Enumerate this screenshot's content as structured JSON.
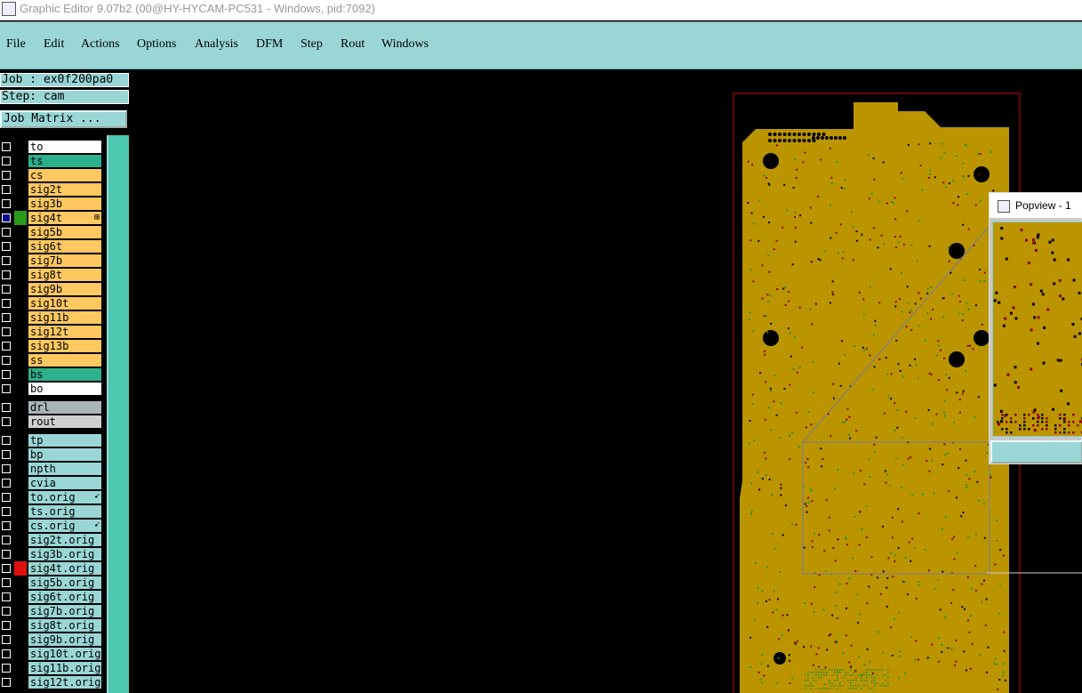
{
  "window": {
    "title": "Graphic Editor 9.07b2 (00@HY-HYCAM-PC531 - Windows, pid:7092)"
  },
  "menu": [
    "File",
    "Edit",
    "Actions",
    "Options",
    "Analysis",
    "DFM",
    "Step",
    "Rout",
    "Windows"
  ],
  "info": {
    "job": "Job : ex0f200pa0",
    "step": "Step: cam",
    "job_matrix": "Job Matrix ..."
  },
  "colors": {
    "board": "#bb9500",
    "board_outline": "#d00000",
    "menu_bg": "#9ad6d6",
    "layer_signal": "#ffc861",
    "layer_mask": "#2db08c",
    "layer_white": "#ffffff",
    "layer_drill": "#a8b4b8",
    "layer_rout": "#d0d0d0",
    "layer_misc": "#9ad6d6"
  },
  "layers": [
    {
      "name": "to",
      "type": "white"
    },
    {
      "name": "ts",
      "type": "mask"
    },
    {
      "name": "cs",
      "type": "signal"
    },
    {
      "name": "sig2t",
      "type": "signal"
    },
    {
      "name": "sig3b",
      "type": "signal"
    },
    {
      "name": "sig4t",
      "type": "signal",
      "checked": true,
      "swatch": "#2a9a1a",
      "mark": "⊞"
    },
    {
      "name": "sig5b",
      "type": "signal"
    },
    {
      "name": "sig6t",
      "type": "signal"
    },
    {
      "name": "sig7b",
      "type": "signal"
    },
    {
      "name": "sig8t",
      "type": "signal"
    },
    {
      "name": "sig9b",
      "type": "signal"
    },
    {
      "name": "sig10t",
      "type": "signal"
    },
    {
      "name": "sig11b",
      "type": "signal"
    },
    {
      "name": "sig12t",
      "type": "signal"
    },
    {
      "name": "sig13b",
      "type": "signal"
    },
    {
      "name": "ss",
      "type": "signal"
    },
    {
      "name": "bs",
      "type": "mask"
    },
    {
      "name": "bo",
      "type": "white"
    },
    {
      "name": "drl",
      "type": "drill",
      "gap": true
    },
    {
      "name": "rout",
      "type": "rout"
    },
    {
      "name": "tp",
      "type": "misc",
      "gap": true
    },
    {
      "name": "bp",
      "type": "misc"
    },
    {
      "name": "npth",
      "type": "misc"
    },
    {
      "name": "cvia",
      "type": "misc"
    },
    {
      "name": "to.orig",
      "type": "misc",
      "mark": "➹"
    },
    {
      "name": "ts.orig",
      "type": "misc"
    },
    {
      "name": "cs.orig",
      "type": "misc",
      "mark": "➹"
    },
    {
      "name": "sig2t.orig",
      "type": "misc"
    },
    {
      "name": "sig3b.orig",
      "type": "misc"
    },
    {
      "name": "sig4t.orig",
      "type": "misc",
      "swatch": "#e01010"
    },
    {
      "name": "sig5b.orig",
      "type": "misc"
    },
    {
      "name": "sig6t.orig",
      "type": "misc"
    },
    {
      "name": "sig7b.orig",
      "type": "misc"
    },
    {
      "name": "sig8t.orig",
      "type": "misc"
    },
    {
      "name": "sig9b.orig",
      "type": "misc"
    },
    {
      "name": "sig10t.orig",
      "type": "misc"
    },
    {
      "name": "sig11b.orig",
      "type": "misc"
    },
    {
      "name": "sig12t.orig",
      "type": "misc"
    }
  ],
  "popview": {
    "title": "Popview - 1"
  }
}
